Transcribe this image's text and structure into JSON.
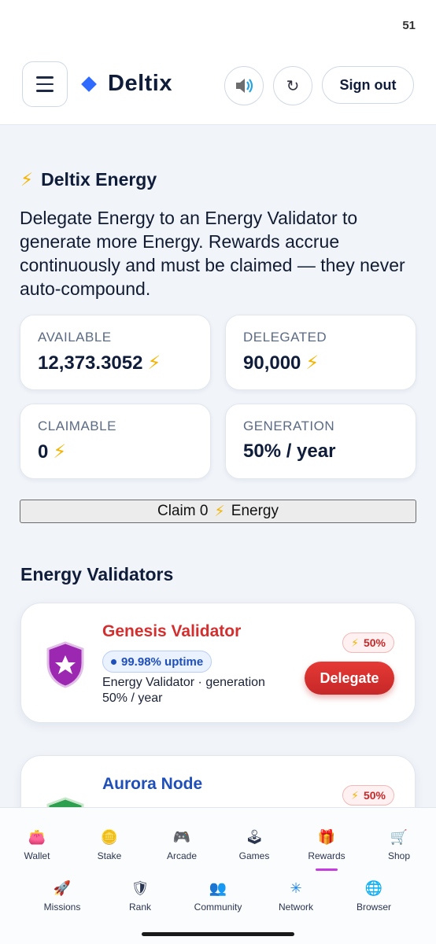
{
  "status": {
    "clock": "51"
  },
  "header": {
    "brand": "Deltix",
    "signout_label": "Sign out",
    "refresh_glyph": "↻"
  },
  "energy": {
    "title": "Deltix Energy",
    "bolt": "⚡",
    "description": "Delegate Energy to an Energy Validator to generate more Energy. Rewards accrue continuously and must be claimed — they never auto-compound.",
    "stats": [
      {
        "label": "AVAILABLE",
        "value": "12,373.3052"
      },
      {
        "label": "DELEGATED",
        "value": "90,000"
      },
      {
        "label": "CLAIMABLE",
        "value": "0"
      },
      {
        "label": "GENERATION",
        "value": "50% / year"
      }
    ],
    "claim": {
      "prefix": "Claim 0",
      "suffix": "Energy"
    }
  },
  "validators": {
    "title": "Energy Validators",
    "items": [
      {
        "name": "Genesis Validator",
        "uptime": "99.98% uptime",
        "desc": "Energy Validator · generation 50% / year",
        "badge": "50%",
        "action": "Delegate",
        "name_color": "#d32f2f",
        "icon_color": "#9c27b0"
      },
      {
        "name": "Aurora Node",
        "badge": "50%",
        "name_color": "#1f4fb8",
        "icon_color": "#2e9e4f"
      }
    ]
  },
  "nav": {
    "row1": [
      {
        "label": "Wallet",
        "icon": "👛"
      },
      {
        "label": "Stake",
        "icon": "🪙"
      },
      {
        "label": "Arcade",
        "icon": "🎮"
      },
      {
        "label": "Games",
        "icon": "🕹"
      },
      {
        "label": "Rewards",
        "icon": "🎁"
      },
      {
        "label": "Shop",
        "icon": "🛒"
      }
    ],
    "row2": [
      {
        "label": "Missions",
        "icon": "🚀"
      },
      {
        "label": "Rank",
        "icon": "🛡"
      },
      {
        "label": "Community",
        "icon": "👥"
      },
      {
        "label": "Network",
        "icon": "✳"
      },
      {
        "label": "Browser",
        "icon": "🌐"
      }
    ]
  },
  "colors": {
    "accent": "#2f6bff",
    "danger": "#d32f2f",
    "active_tab": "#c63ce0"
  }
}
